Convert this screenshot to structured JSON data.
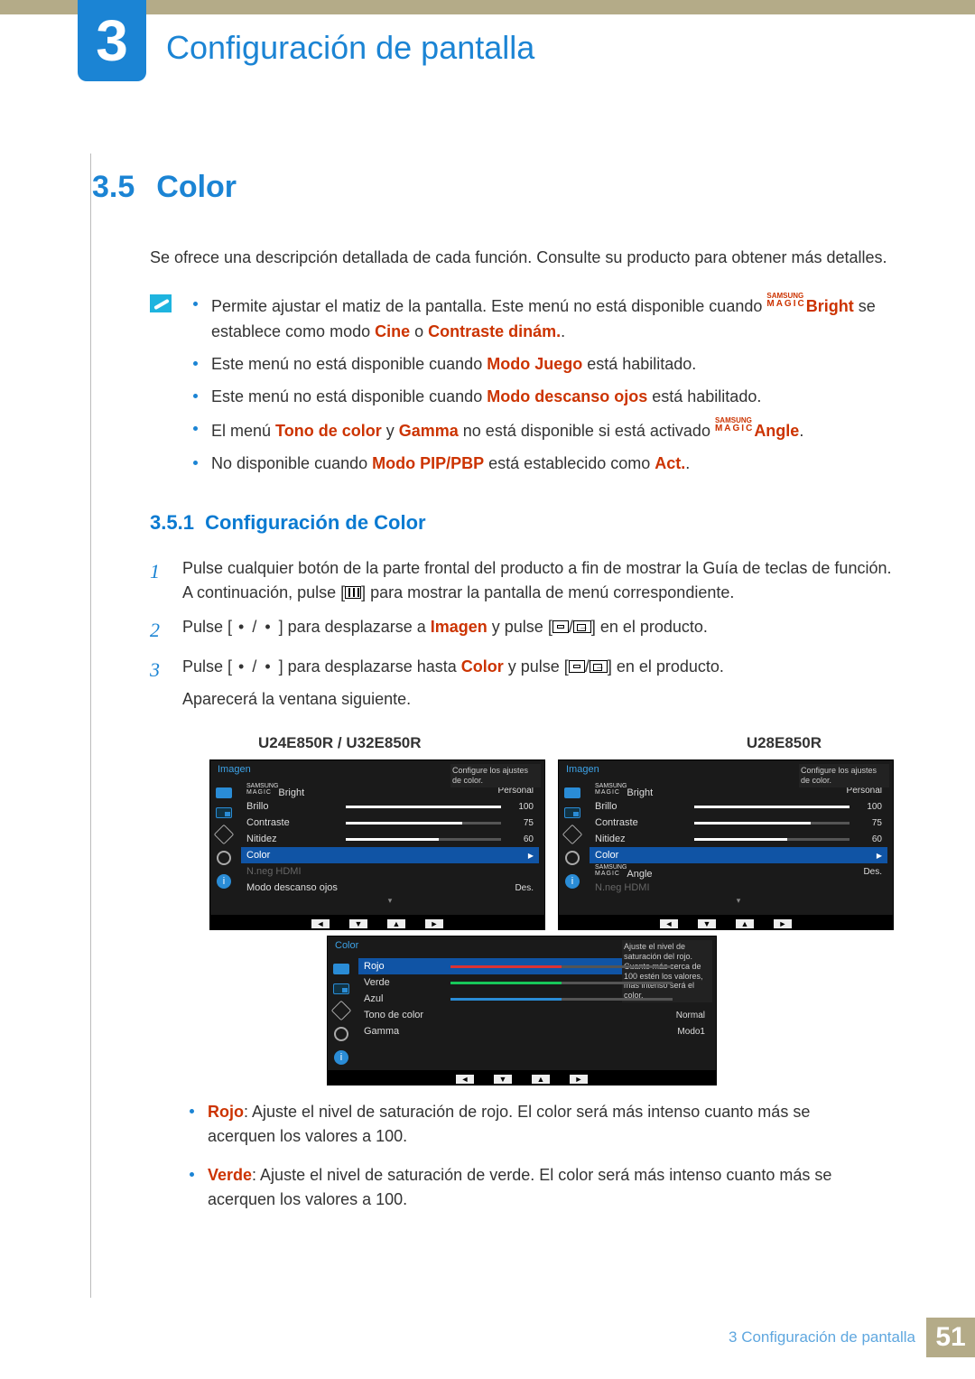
{
  "chapter": {
    "number": "3",
    "title": "Configuración de pantalla"
  },
  "section": {
    "number": "3.5",
    "title": "Color"
  },
  "intro": "Se ofrece una descripción detallada de cada función. Consulte su producto para obtener más detalles.",
  "notes": {
    "b1_pre": "Permite ajustar el matiz de la pantalla. Este menú no está disponible cuando ",
    "b1_magic_top": "SAMSUNG",
    "b1_magic_bot": "MAGIC",
    "b1_bright": "Bright",
    "b1_mid": " se establece como modo ",
    "b1_cine": "Cine",
    "b1_or": " o ",
    "b1_contrast": "Contraste dinám.",
    "b1_end": ".",
    "b2_pre": "Este menú no está disponible cuando ",
    "b2_hl": "Modo Juego",
    "b2_end": " está habilitado.",
    "b3_pre": "Este menú no está disponible cuando ",
    "b3_hl": "Modo descanso ojos",
    "b3_end": " está habilitado.",
    "b4_pre": "El menú ",
    "b4_tono": "Tono de color",
    "b4_y": " y ",
    "b4_gamma": "Gamma",
    "b4_mid": " no está disponible si está activado ",
    "b4_magic_top": "SAMSUNG",
    "b4_magic_bot": "MAGIC",
    "b4_angle": "Angle",
    "b4_end": ".",
    "b5_pre": "No disponible cuando ",
    "b5_hl": "Modo PIP/PBP",
    "b5_mid": " está establecido como ",
    "b5_act": "Act.",
    "b5_end": "."
  },
  "subsection": {
    "number": "3.5.1",
    "title": "Configuración de Color"
  },
  "steps": {
    "s1a": "Pulse cualquier botón de la parte frontal del producto a fin de mostrar la Guía de teclas de función. A continuación, pulse [",
    "s1b": "] para mostrar la pantalla de menú correspondiente.",
    "s2a": "Pulse [",
    "s2dots": " • / • ",
    "s2b": "] para desplazarse a ",
    "s2hl": "Imagen",
    "s2c": " y pulse [",
    "s2d": "] en el producto.",
    "s3a": "Pulse [",
    "s3dots": " • / • ",
    "s3b": "] para desplazarse hasta ",
    "s3hl": "Color",
    "s3c": " y pulse [",
    "s3d": "] en el producto.",
    "s3e": "Aparecerá la ventana siguiente."
  },
  "labels": {
    "left": "U24E850R / U32E850R",
    "right": "U28E850R"
  },
  "osd": {
    "imagen": "Imagen",
    "magic_top": "SAMSUNG",
    "magic_bot": "MAGIC",
    "bright": "Bright",
    "angle": "Angle",
    "personal": "Personal",
    "brillo": "Brillo",
    "brillo_v": "100",
    "contraste": "Contraste",
    "contraste_v": "75",
    "nitidez": "Nitidez",
    "nitidez_v": "60",
    "color": "Color",
    "nneg": "N.neg HDMI",
    "descanso": "Modo descanso ojos",
    "des": "Des.",
    "tooltip1": "Configure los ajustes de color.",
    "color_title": "Color",
    "rojo": "Rojo",
    "rojo_v": "50",
    "verde": "Verde",
    "verde_v": "50",
    "azul": "Azul",
    "azul_v": "50",
    "tono": "Tono de color",
    "normal": "Normal",
    "gamma": "Gamma",
    "modo1": "Modo1",
    "tooltip2": "Ajuste el nivel de saturación del rojo. Cuanto más cerca de 100 estén los valores, más intenso será el color.",
    "nav_l": "◄",
    "nav_d": "▼",
    "nav_u": "▲",
    "nav_r": "►"
  },
  "desc": {
    "rojo_lbl": "Rojo",
    "rojo_txt": ": Ajuste el nivel de saturación de rojo. El color será más intenso cuanto más se acerquen los valores a 100.",
    "verde_lbl": "Verde",
    "verde_txt": ": Ajuste el nivel de saturación de verde. El color será más intenso cuanto más se acerquen los valores a 100."
  },
  "footer": {
    "text": "3 Configuración de pantalla",
    "page": "51"
  }
}
